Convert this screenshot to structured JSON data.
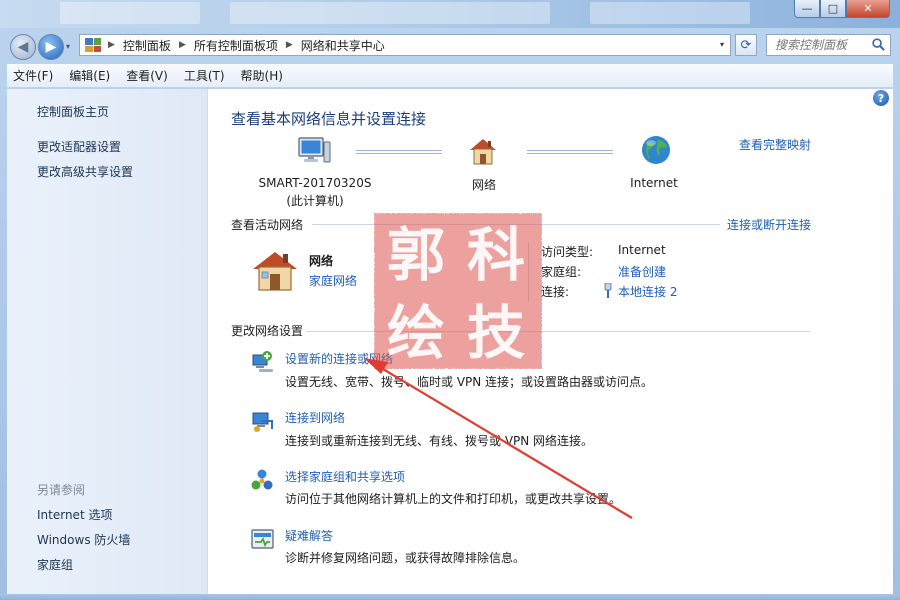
{
  "window": {
    "minimize_glyph": "—",
    "maximize_glyph": "□",
    "close_glyph": "✕"
  },
  "nav": {
    "back_glyph": "◀",
    "forward_glyph": "▶",
    "dropdown_glyph": "▾",
    "refresh_glyph": "⟳"
  },
  "address": {
    "breadcrumbs": [
      "控制面板",
      "所有控制面板项",
      "网络和共享中心"
    ],
    "separator": "▶"
  },
  "search": {
    "placeholder": "搜索控制面板"
  },
  "menubar": {
    "items": [
      "文件(F)",
      "编辑(E)",
      "查看(V)",
      "工具(T)",
      "帮助(H)"
    ]
  },
  "sidebar": {
    "links": [
      "控制面板主页",
      "更改适配器设置",
      "更改高级共享设置"
    ],
    "see_also_title": "另请参阅",
    "see_also": [
      "Internet 选项",
      "Windows 防火墙",
      "家庭组"
    ]
  },
  "main": {
    "title": "查看基本网络信息并设置连接",
    "full_map_link": "查看完整映射",
    "help_glyph": "?",
    "map": {
      "computer_name": "SMART-20170320S",
      "computer_sub": "(此计算机)",
      "network_label": "网络",
      "internet_label": "Internet"
    },
    "active_section_title": "查看活动网络",
    "connect_disconnect_link": "连接或断开连接",
    "active_network": {
      "name": "网络",
      "type": "家庭网络",
      "access_type_label": "访问类型:",
      "access_type_value": "Internet",
      "homegroup_label": "家庭组:",
      "homegroup_value": "准备创建",
      "connection_label": "连接:",
      "connection_value": "本地连接 2"
    },
    "change_section_title": "更改网络设置",
    "tasks": [
      {
        "link": "设置新的连接或网络",
        "desc": "设置无线、宽带、拨号、临时或 VPN 连接；或设置路由器或访问点。"
      },
      {
        "link": "连接到网络",
        "desc": "连接到或重新连接到无线、有线、拨号或 VPN 网络连接。"
      },
      {
        "link": "选择家庭组和共享选项",
        "desc": "访问位于其他网络计算机上的文件和打印机，或更改共享设置。"
      },
      {
        "link": "疑难解答",
        "desc": "诊断并修复网络问题，或获得故障排除信息。"
      }
    ]
  },
  "watermark": {
    "chars": [
      "郭",
      "科",
      "绘",
      "技"
    ]
  },
  "colors": {
    "link": "#1f5fb4",
    "title": "#1c3e78",
    "seal": "#e0564f",
    "arrow": "#e23b2f"
  }
}
